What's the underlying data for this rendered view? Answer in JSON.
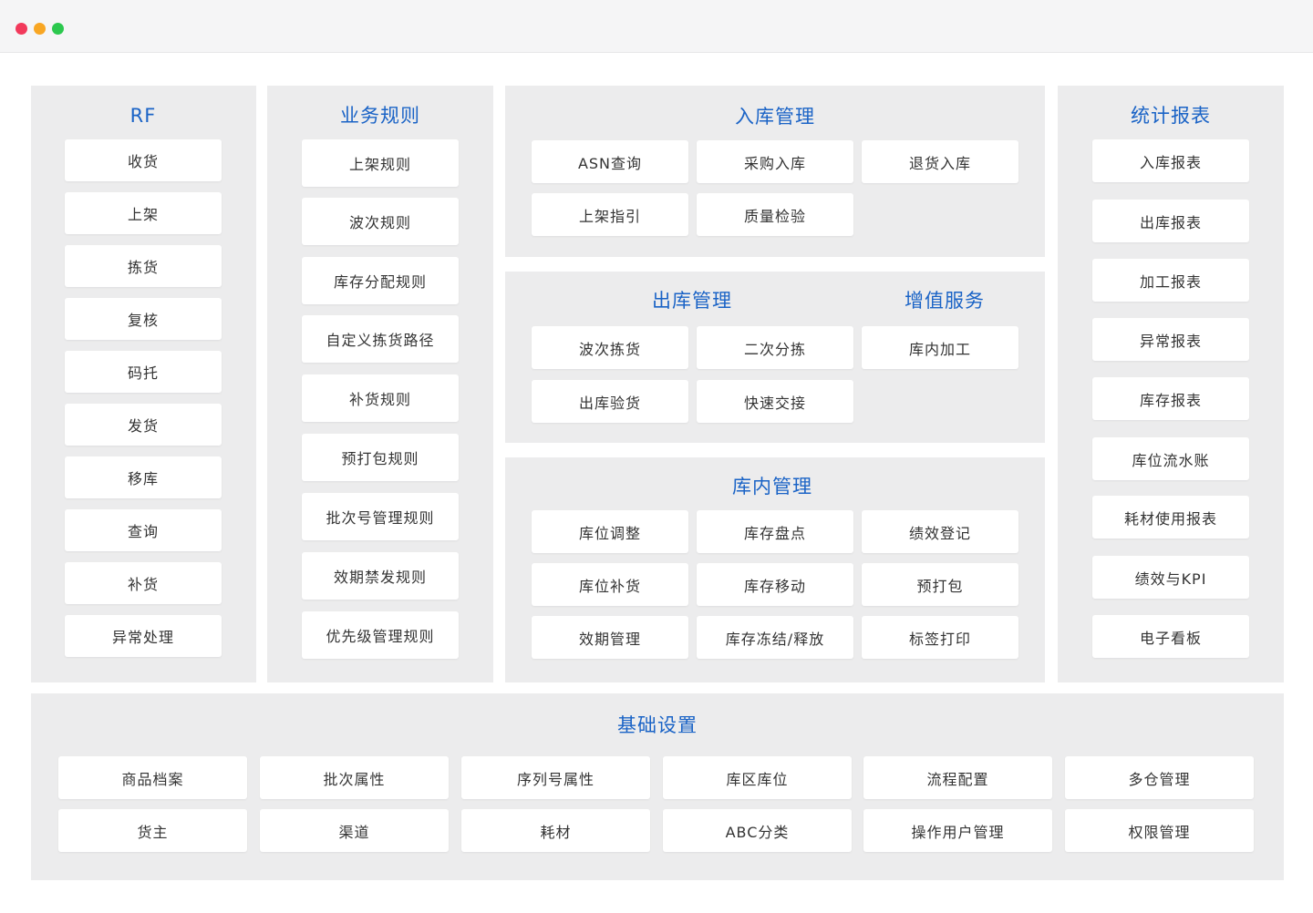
{
  "window": {
    "controls": [
      "close",
      "minimize",
      "maximize"
    ]
  },
  "colors": {
    "title_blue": "#1a63c6",
    "panel_bg": "#ececed",
    "button_bg": "#ffffff",
    "text": "#333333"
  },
  "rf": {
    "title": "RF",
    "items": [
      "收货",
      "上架",
      "拣货",
      "复核",
      "码托",
      "发货",
      "移库",
      "查询",
      "补货",
      "异常处理"
    ]
  },
  "business_rules": {
    "title": "业务规则",
    "items": [
      "上架规则",
      "波次规则",
      "库存分配规则",
      "自定义拣货路径",
      "补货规则",
      "预打包规则",
      "批次号管理规则",
      "效期禁发规则",
      "优先级管理规则"
    ]
  },
  "inbound": {
    "title": "入库管理",
    "items": [
      "ASN查询",
      "采购入库",
      "退货入库",
      "上架指引",
      "质量检验"
    ]
  },
  "outbound": {
    "title": "出库管理",
    "items": [
      "波次拣货",
      "二次分拣",
      "出库验货",
      "快速交接"
    ]
  },
  "value_added": {
    "title": "增值服务",
    "items": [
      "库内加工"
    ]
  },
  "warehouse": {
    "title": "库内管理",
    "items": [
      "库位调整",
      "库存盘点",
      "绩效登记",
      "库位补货",
      "库存移动",
      "预打包",
      "效期管理",
      "库存冻结/释放",
      "标签打印"
    ]
  },
  "reports": {
    "title": "统计报表",
    "items": [
      "入库报表",
      "出库报表",
      "加工报表",
      "异常报表",
      "库存报表",
      "库位流水账",
      "耗材使用报表",
      "绩效与KPI",
      "电子看板"
    ]
  },
  "basic": {
    "title": "基础设置",
    "items": [
      "商品档案",
      "批次属性",
      "序列号属性",
      "库区库位",
      "流程配置",
      "多仓管理",
      "货主",
      "渠道",
      "耗材",
      "ABC分类",
      "操作用户管理",
      "权限管理"
    ]
  }
}
